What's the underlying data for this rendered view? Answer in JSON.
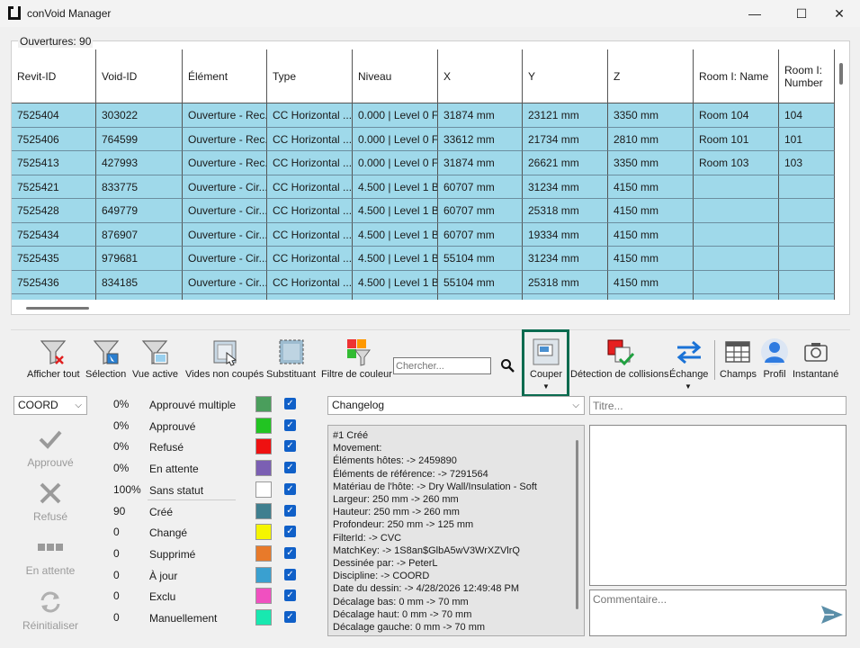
{
  "window": {
    "title": "conVoid Manager",
    "minimize": "—",
    "maximize": "☐",
    "close": "✕"
  },
  "grid": {
    "group_label": "Ouvertures: 90",
    "columns": [
      "Revit-ID",
      "Void-ID",
      "Élément",
      "Type",
      "Niveau",
      "X",
      "Y",
      "Z",
      "Room I: Name",
      "Room I: Number"
    ],
    "rows": [
      [
        "7525404",
        "303022",
        "Ouverture - Rec...",
        "CC Horizontal ...",
        "0.000 | Level 0 FF",
        "31874 mm",
        "23121 mm",
        "3350 mm",
        "Room 104",
        "104"
      ],
      [
        "7525406",
        "764599",
        "Ouverture - Rec...",
        "CC Horizontal ...",
        "0.000 | Level 0 FF",
        "33612 mm",
        "21734 mm",
        "2810 mm",
        "Room 101",
        "101"
      ],
      [
        "7525413",
        "427993",
        "Ouverture - Rec...",
        "CC Horizontal ...",
        "0.000 | Level 0 FF",
        "31874 mm",
        "26621 mm",
        "3350 mm",
        "Room 103",
        "103"
      ],
      [
        "7525421",
        "833775",
        "Ouverture - Cir...",
        "CC Horizontal ...",
        "4.500 | Level 1 B...",
        "60707 mm",
        "31234 mm",
        "4150 mm",
        "",
        ""
      ],
      [
        "7525428",
        "649779",
        "Ouverture - Cir...",
        "CC Horizontal ...",
        "4.500 | Level 1 B...",
        "60707 mm",
        "25318 mm",
        "4150 mm",
        "",
        ""
      ],
      [
        "7525434",
        "876907",
        "Ouverture - Cir...",
        "CC Horizontal ...",
        "4.500 | Level 1 B...",
        "60707 mm",
        "19334 mm",
        "4150 mm",
        "",
        ""
      ],
      [
        "7525435",
        "979681",
        "Ouverture - Cir...",
        "CC Horizontal ...",
        "4.500 | Level 1 B...",
        "55104 mm",
        "31234 mm",
        "4150 mm",
        "",
        ""
      ],
      [
        "7525436",
        "834185",
        "Ouverture - Cir...",
        "CC Horizontal ...",
        "4.500 | Level 1 B...",
        "55104 mm",
        "25318 mm",
        "4150 mm",
        "",
        ""
      ],
      [
        "",
        "",
        "",
        "",
        "",
        "",
        "",
        "",
        "",
        ""
      ]
    ]
  },
  "toolbar": {
    "show_all": "Afficher tout",
    "selection": "Sélection",
    "active_view": "Vue active",
    "uncut_voids": "Vides non coupés",
    "substitute": "Substituant",
    "color_filter": "Filtre de couleur",
    "search_placeholder": "Chercher...",
    "cut": "Couper",
    "collision": "Détection de collisions",
    "exchange": "Échange",
    "fields": "Champs",
    "profile": "Profil",
    "snapshot": "Instantané"
  },
  "left": {
    "discipline": "COORD",
    "approve": "Approuvé",
    "reject": "Refusé",
    "pending": "En attente",
    "reset": "Réinitialiser"
  },
  "statuses": [
    {
      "pct": "0%",
      "name": "Approuvé multiple",
      "color": "#4a9e5c"
    },
    {
      "pct": "0%",
      "name": "Approuvé",
      "color": "#22c422"
    },
    {
      "pct": "0%",
      "name": "Refusé",
      "color": "#ee1111"
    },
    {
      "pct": "0%",
      "name": "En attente",
      "color": "#7b5fb3"
    },
    {
      "pct": "100%",
      "name": "Sans statut",
      "color": "#ffffff"
    },
    {
      "pct": "90",
      "name": "Créé",
      "color": "#3f7f8f"
    },
    {
      "pct": "0",
      "name": "Changé",
      "color": "#f5f500"
    },
    {
      "pct": "0",
      "name": "Supprimé",
      "color": "#e87a2a"
    },
    {
      "pct": "0",
      "name": "À jour",
      "color": "#3aa0d0"
    },
    {
      "pct": "0",
      "name": "Exclu",
      "color": "#f050c0"
    },
    {
      "pct": "0",
      "name": "Manuellement",
      "color": "#18e8b0"
    }
  ],
  "changelog": {
    "selected": "Changelog",
    "lines": [
      "#1 Créé",
      "Movement:",
      "Éléments hôtes:  -> 2459890",
      "Éléments de référence:  -> 7291564",
      "Matériau de l'hôte:  -> Dry Wall/Insulation - Soft",
      "Largeur: 250 mm -> 260 mm",
      "Hauteur: 250 mm -> 260 mm",
      "Profondeur: 250 mm -> 125 mm",
      "FilterId:  -> CVC",
      "MatchKey:  -> 1S8an$GlbA5wV3WrXZVlrQ",
      "Dessinée par:  -> PeterL",
      "Discipline:  -> COORD",
      "Date du dessin:  -> 4/28/2026 12:49:48 PM",
      "Décalage bas: 0 mm -> 70 mm",
      "Décalage haut: 0 mm -> 70 mm",
      "Décalage gauche: 0 mm -> 70 mm"
    ]
  },
  "right": {
    "title_placeholder": "Titre...",
    "comment_placeholder": "Commentaire..."
  }
}
